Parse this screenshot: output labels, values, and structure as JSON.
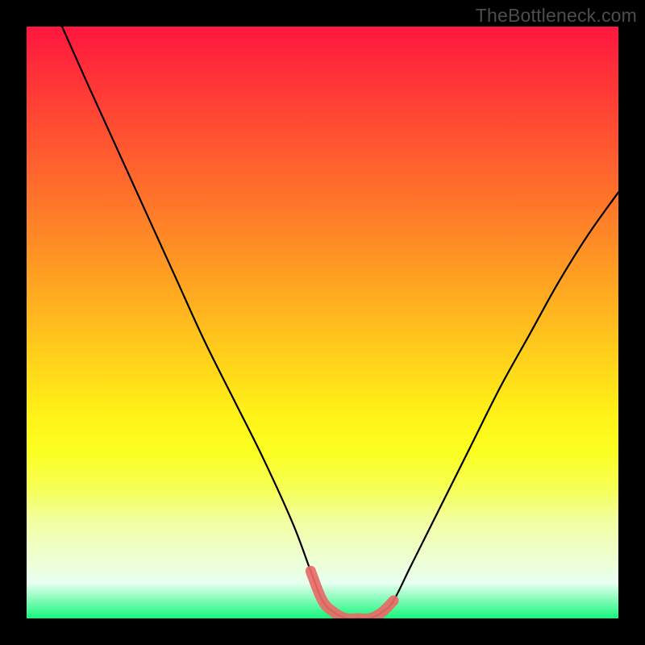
{
  "watermark": "TheBottleneck.com",
  "chart_data": {
    "type": "line",
    "title": "",
    "xlabel": "",
    "ylabel": "",
    "xlim": [
      0,
      100
    ],
    "ylim": [
      0,
      100
    ],
    "series": [
      {
        "name": "bottleneck-curve",
        "x": [
          6,
          10,
          15,
          20,
          25,
          30,
          35,
          40,
          45,
          48,
          50,
          52,
          54,
          56,
          58,
          60,
          62,
          65,
          70,
          75,
          80,
          85,
          90,
          95,
          100
        ],
        "values": [
          100,
          91,
          80,
          69,
          58,
          47,
          37,
          27,
          16,
          8,
          3,
          1,
          0,
          0,
          0,
          1,
          3,
          9,
          19,
          29,
          39,
          48,
          57,
          65,
          72
        ]
      }
    ],
    "highlight": {
      "name": "optimal-zone",
      "x": [
        48,
        50,
        52,
        54,
        56,
        58,
        60,
        62
      ],
      "values": [
        8,
        3,
        1,
        0,
        0,
        0,
        1,
        3
      ]
    },
    "gradient_stops": [
      {
        "pct": 0,
        "color": "#ff163f"
      },
      {
        "pct": 50,
        "color": "#ffca1d"
      },
      {
        "pct": 78,
        "color": "#f6ff55"
      },
      {
        "pct": 100,
        "color": "#14f77a"
      }
    ]
  }
}
